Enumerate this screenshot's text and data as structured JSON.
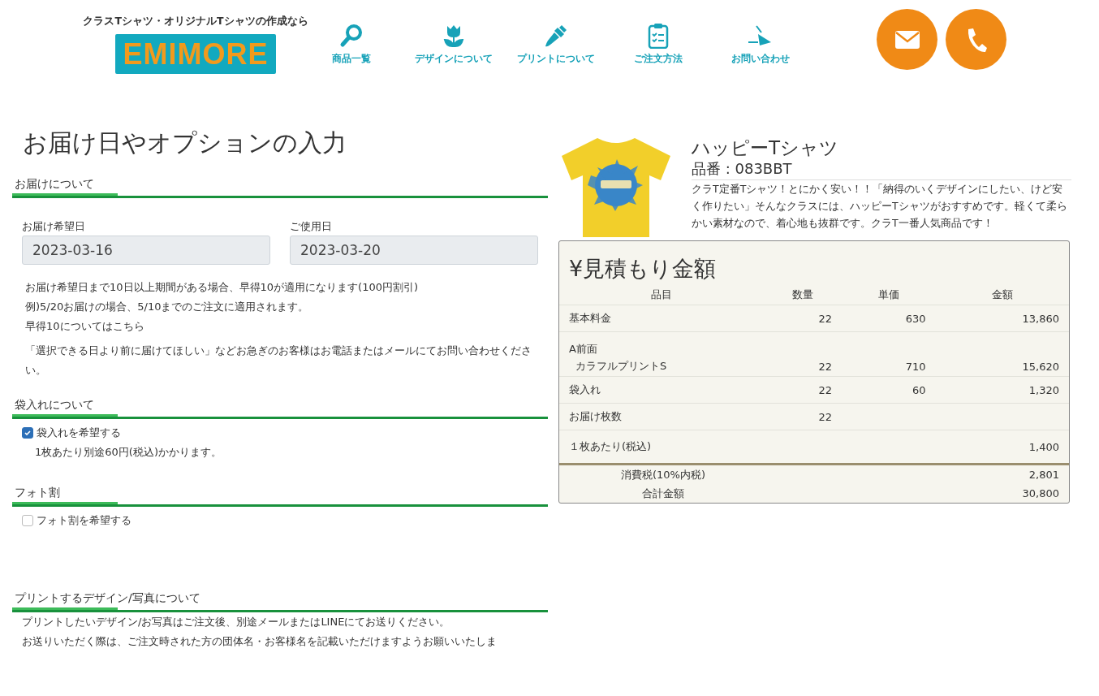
{
  "header": {
    "tagline": "クラスTシャツ・オリジナルTシャツの作成なら",
    "logo": "EMIMORE",
    "nav": [
      {
        "label": "商品一覧"
      },
      {
        "label": "デザインについて"
      },
      {
        "label": "プリントについて"
      },
      {
        "label": "ご注文方法"
      },
      {
        "label": "お問い合わせ"
      }
    ]
  },
  "page_title": "お届け日やオプションの入力",
  "delivery": {
    "heading": "お届けについて",
    "fields": [
      {
        "label": "お届け希望日",
        "value": "2023-03-16"
      },
      {
        "label": "ご使用日",
        "value": "2023-03-20"
      }
    ],
    "notes": [
      "お届け希望日まで10日以上期間がある場合、早得10が適用になります(100円割引)",
      "例)5/20お届けの場合、5/10までのご注文に適用されます。"
    ],
    "link": "早得10についてはこちら",
    "contact_note": "「選択できる日より前に届けてほしい」などお急ぎのお客様はお電話またはメールにてお問い合わせください。"
  },
  "bagging": {
    "heading": "袋入れについて",
    "option": {
      "label": "袋入れを希望する",
      "checked": true
    },
    "note": "1枚あたり別途60円(税込)かかります。"
  },
  "photo": {
    "heading": "フォト割",
    "option": {
      "label": "フォト割を希望する",
      "checked": false
    }
  },
  "print_design": {
    "heading": "プリントするデザイン/写真について",
    "lines": [
      "プリントしたいデザイン/お写真はご注文後、別途メールまたはLINEにてお送りください。",
      "お送りいただく際は、ご注文時された方の団体名・お客様名を記載いただけますようお願いいたしま"
    ]
  },
  "product": {
    "name": "ハッピーTシャツ",
    "code": "品番 : 083BBT",
    "description": "クラT定番Tシャツ！とにかく安い！！「納得のいくデザインにしたい、けど安く作りたい」そんなクラスには、ハッピーTシャツがおすすめです。軽くて柔らかい素材なので、着心地も抜群です。クラT一番人気商品です！"
  },
  "estimate": {
    "title": "¥見積もり金額",
    "columns": [
      "品目",
      "数量",
      "単価",
      "金額"
    ],
    "rows": [
      {
        "kind": "line",
        "item": "基本料金",
        "qty": "22",
        "unit": "630",
        "amount": "13,860"
      },
      {
        "kind": "group",
        "item": "A前面"
      },
      {
        "kind": "sub",
        "item": "カラフルプリントS",
        "qty": "22",
        "unit": "710",
        "amount": "15,620"
      },
      {
        "kind": "line",
        "item": "袋入れ",
        "qty": "22",
        "unit": "60",
        "amount": "1,320"
      },
      {
        "kind": "line",
        "item": "お届け枚数",
        "qty": "22"
      }
    ],
    "per_unit": {
      "label": "１枚あたり(税込)",
      "amount": "1,400"
    },
    "totals": [
      {
        "label": "消費税(10%内税)",
        "amount": "2,801"
      },
      {
        "label": "合計金額",
        "amount": "30,800"
      }
    ]
  }
}
